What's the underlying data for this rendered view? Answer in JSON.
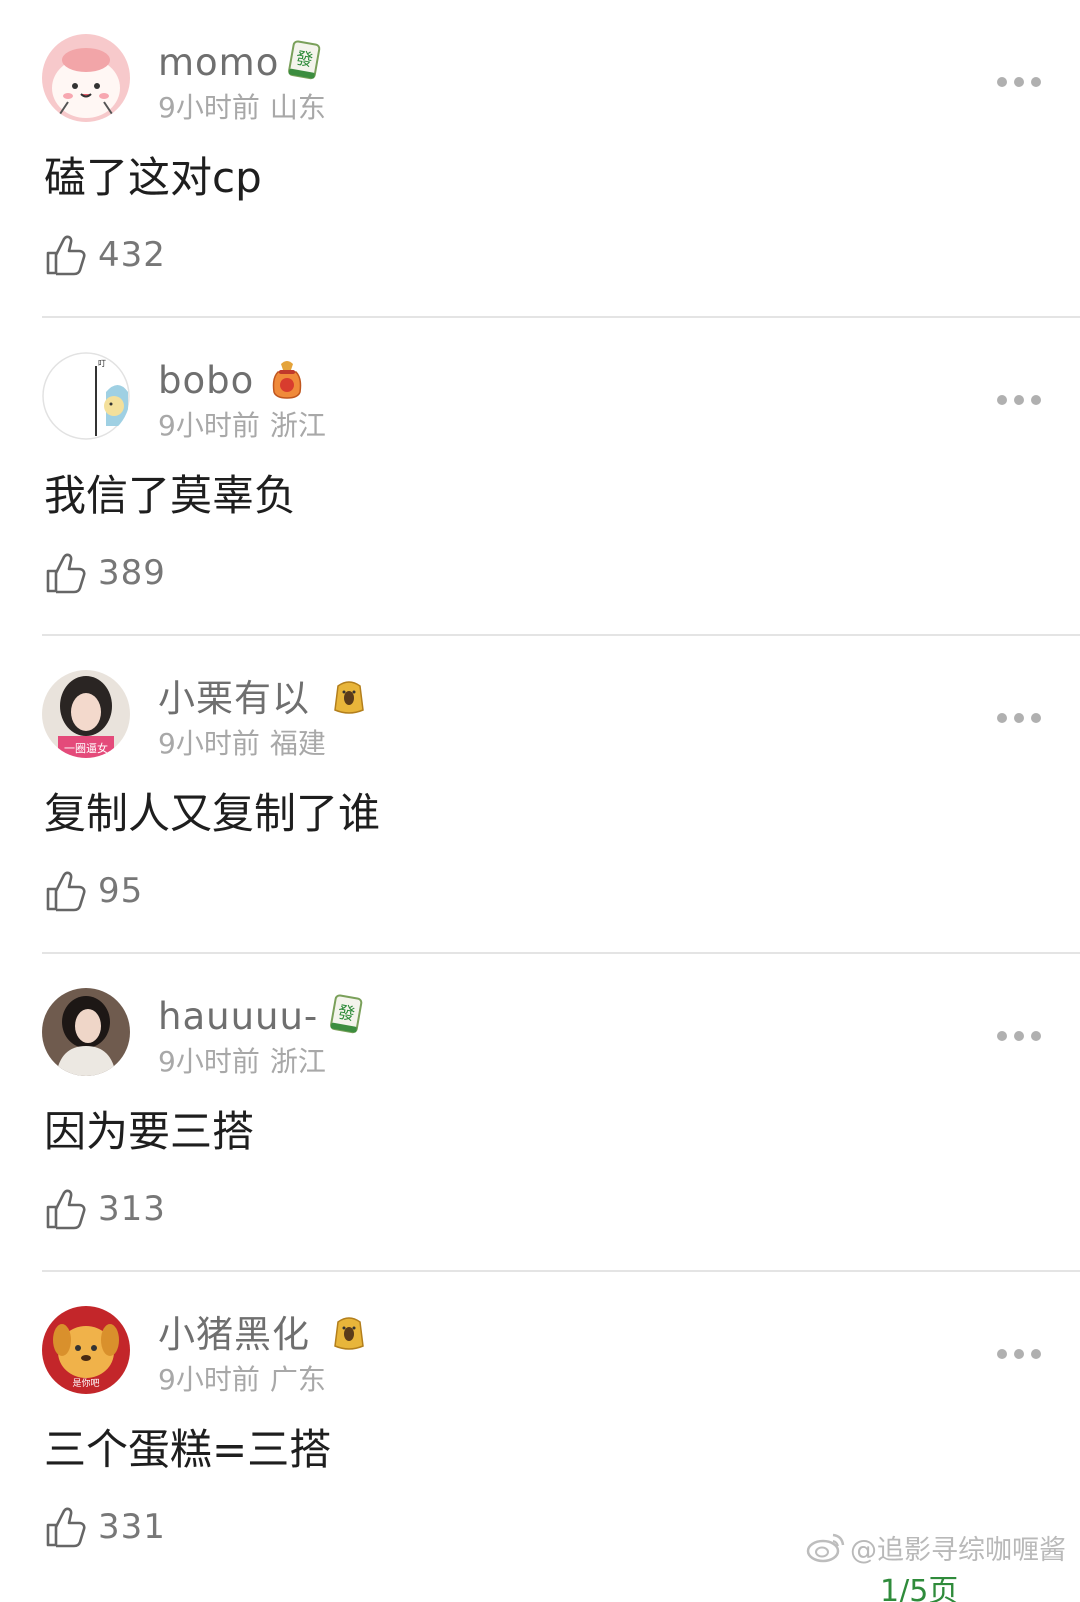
{
  "comments": [
    {
      "username": "momo",
      "time": "9小时前",
      "location": "山东",
      "text": "磕了这对cp",
      "likes": "432",
      "badge": "mahjong-fa-tile"
    },
    {
      "username": "bobo",
      "time": "9小时前",
      "location": "浙江",
      "text": "我信了莫辜负",
      "likes": "389",
      "badge": "lucky-bag"
    },
    {
      "username": "小栗有以",
      "time": "9小时前",
      "location": "福建",
      "text": "复制人又复制了谁",
      "likes": "95",
      "badge": "pudding-bear"
    },
    {
      "username": "hauuuu-",
      "time": "9小时前",
      "location": "浙江",
      "text": "因为要三搭",
      "likes": "313",
      "badge": "mahjong-fa-tile"
    },
    {
      "username": "小猪黑化",
      "time": "9小时前",
      "location": "广东",
      "text": "三个蛋糕=三搭",
      "likes": "331",
      "badge": "pudding-bear"
    }
  ],
  "avatars": [
    {
      "icon": "pink-bunny-avatar"
    },
    {
      "icon": "sketch-avatar",
      "caption": "叮"
    },
    {
      "icon": "girl-photo-avatar",
      "caption": "一圈逼女"
    },
    {
      "icon": "girl-photo-avatar-2"
    },
    {
      "icon": "dog-avatar",
      "caption": "是你吧"
    }
  ],
  "mahjong_char": "發",
  "footer": {
    "watermark": "@追影寻综咖喱酱",
    "pager": "1/5页"
  },
  "colors": {
    "name": "#6f6f6f",
    "meta": "#a8a8a8",
    "text": "#1e1e1e",
    "divider": "#e4e4e4",
    "tile_green": "#2e8b3a",
    "pager_green": "#2f8b3b"
  }
}
